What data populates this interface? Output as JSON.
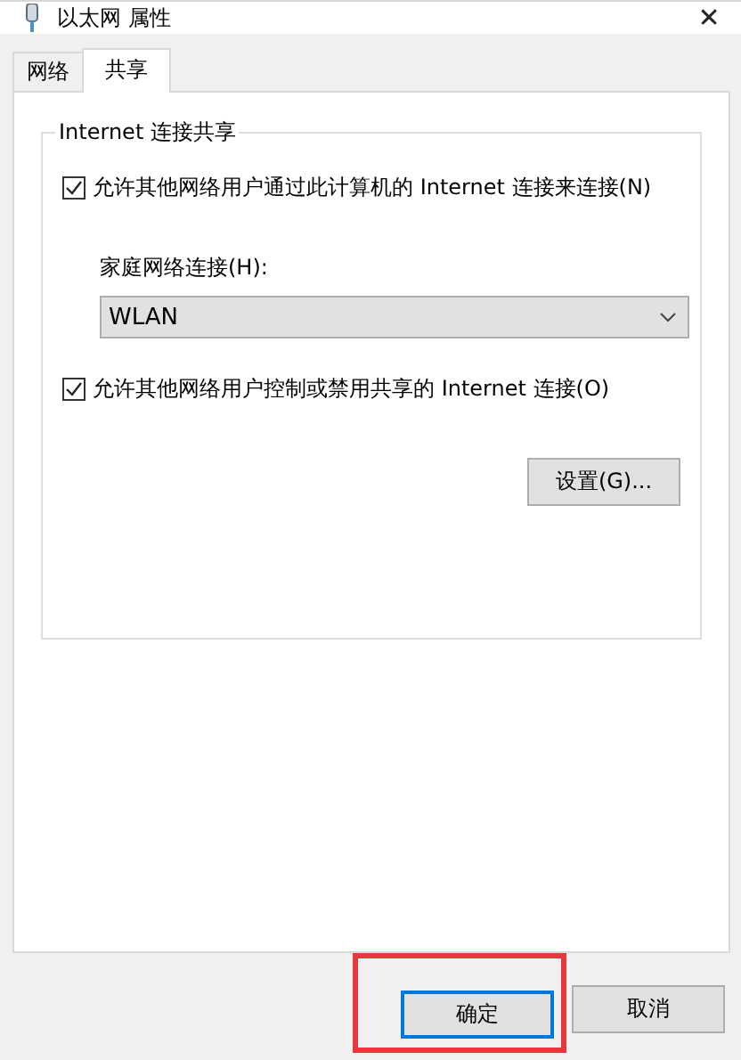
{
  "window": {
    "title": "以太网 属性",
    "close": "✕"
  },
  "tabs": [
    {
      "label": "网络",
      "selected": false
    },
    {
      "label": "共享",
      "selected": true
    }
  ],
  "group": {
    "title": "Internet 连接共享",
    "share_checkbox": {
      "label": "允许其他网络用户通过此计算机的 Internet 连接来连接(N)",
      "checked": true
    },
    "home_network": {
      "label": "家庭网络连接(H):",
      "value": "WLAN"
    },
    "control_checkbox": {
      "label": "允许其他网络用户控制或禁用共享的 Internet 连接(O)",
      "checked": true
    }
  },
  "settings_button": "设置(G)...",
  "buttons": [
    {
      "label": "确定",
      "default": true,
      "highlighted": true
    },
    {
      "label": "取消",
      "default": false,
      "highlighted": false
    }
  ]
}
